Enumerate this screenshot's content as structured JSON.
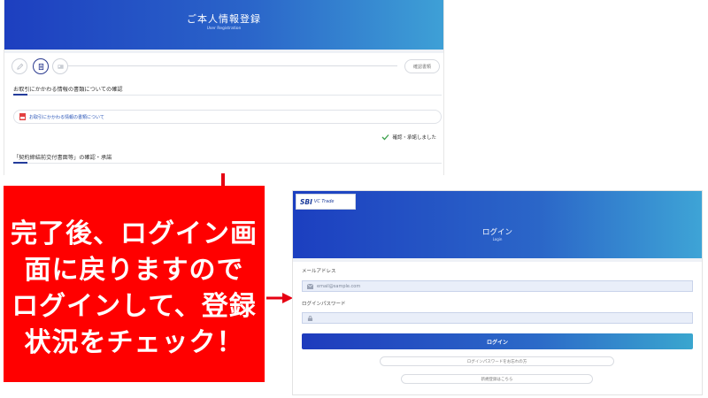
{
  "registration": {
    "title": "ご本人情報登録",
    "subtitle": "User Registration",
    "confirm_label": "確認書類",
    "section1_title": "お取引にかかわる情報の書類についての確認",
    "doc_link_label": "お取引にかかわる情報の書類について",
    "agree_label": "確認・承諾しました",
    "section2_title": "「契約締結前交付書面等」の確認・承諾"
  },
  "callout": {
    "lines": [
      "完了後、ログイン画",
      "面に戻りますので",
      "ログインして、登録",
      "状況をチェック！"
    ],
    "color": "#ff0000"
  },
  "login": {
    "logo_main": "SBI",
    "logo_sub": "VC Trade",
    "title": "ログイン",
    "subtitle": "Login",
    "email_label": "メールアドレス",
    "email_placeholder": "email@sample.com",
    "password_label": "ログインパスワード",
    "login_button": "ログイン",
    "forgot_password": "ログインパスワードをお忘れの方",
    "new_registration": "新規登録はこちら"
  },
  "colors": {
    "header_start": "#1d3fc0",
    "header_end": "#3ea0d6",
    "callout": "#ff0000",
    "accent": "#243c9b"
  }
}
